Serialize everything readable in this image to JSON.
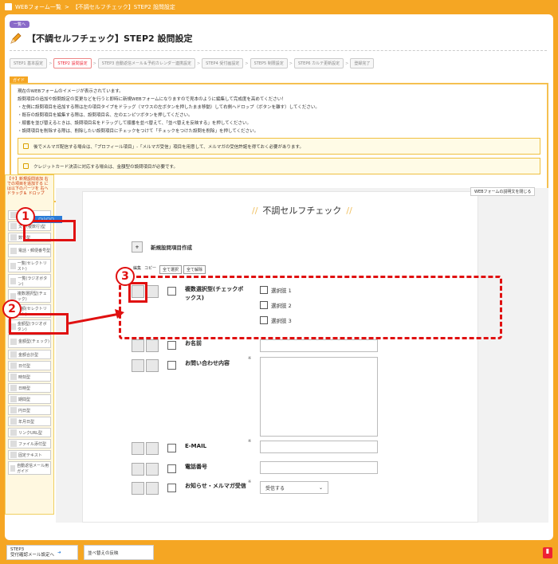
{
  "topbar": {
    "crumb1": "WEBフォーム一覧",
    "crumb2": "【不調セルフチェック】STEP2 設問設定"
  },
  "page": {
    "prev_label": "一覧へ",
    "title": "【不調セルフチェック】STEP2 設問設定"
  },
  "steps": [
    {
      "label": "STEP1 基本設定",
      "active": false
    },
    {
      "label": "STEP2 設問設定",
      "active": true
    },
    {
      "label": "STEP3 自動返信メール＆予約カレンダー連携設定",
      "active": false
    },
    {
      "label": "STEP4 受付画設定",
      "active": false
    },
    {
      "label": "STEP5 制限設定",
      "active": false
    },
    {
      "label": "STEP6 カルテ更新設定",
      "active": false
    },
    {
      "label": "登録完了",
      "active": false
    }
  ],
  "guide": {
    "label": "ガイド",
    "lines": [
      "現在のWEBフォームのイメージが表示されています。",
      "設問項目の追加や設問設定の変更などを行うと即時に新規WEBフォームになりますので見本のように編集して完成度を高めてください！",
      "・左側に設問項目を追加する際は左の項目タイプをドラッグ（マウスの左ボタンを押したまま移動）して右側へドロップ（ボタンを離す）してください。",
      "・既存の設問項目を編集する際は、設問項目名、左のエンピツボタンを押してください。",
      "・順番を並び替えるときは、設問項目名をドラッグして順番を並べ替えて、「並べ替えを反映する」を押してください。",
      "・設問項目を削除する際は、削除したい設問項目にチェックをつけて「チェックをつけた設問を削除」を押してください。"
    ],
    "note1": "後でメルマガ配信する場合は、「プロフィール項目」-「メルマガ受信」項目を用意して、メルマガの受信許諾を得ておく必要があります。",
    "note2": "クレジットカード決済に対応する場合は、金額型の設問項目が必要です。"
  },
  "sidebar": {
    "header": "【十】新規設問追加 右での項目を追加する には以下のパーツを 右へドラッグ＆ ドロップ",
    "blue_item": "ロ山ロロ",
    "items": [
      "氏名",
      "文字(複数行)型",
      "数字型",
      "電話・郵便番号型",
      "一覧(セレクトリスト)",
      "一覧(ラジオボタン)",
      "複数選択型(チェック)",
      "金額(セレクトリスト)",
      "金額型(ラジオボタン)",
      "金額型(チェック)",
      "金額合計型",
      "日付型",
      "時刻型",
      "日時型",
      "期間型",
      "円日型",
      "年月日型",
      "リンクURL型",
      "ファイル添付型",
      "固定テキスト",
      "自動返信メール用ガイド"
    ]
  },
  "main": {
    "full_button": "WEBフォームの説明文を閉じる",
    "form_title": "不調セルフチェック",
    "new_question": "新規設問項目作成",
    "tools": {
      "edit": "編集",
      "copy": "コピー",
      "select_all": "全て選択",
      "deselect_all": "全て解除"
    },
    "questions": [
      {
        "label": "複数選択型(チェックボックス)",
        "options": [
          "選択肢 1",
          "選択肢 2",
          "選択肢 3"
        ]
      },
      {
        "label": "お名前"
      },
      {
        "label": "お問い合わせ内容",
        "required": "※"
      },
      {
        "label": "E-MAIL",
        "required": "※"
      },
      {
        "label": "電話番号"
      },
      {
        "label": "お知らせ・メルマガ受信",
        "required": "※",
        "select": "受信する"
      }
    ]
  },
  "bottom": {
    "step3_line1": "STEP3",
    "step3_line2": "受付確認メール設定へ",
    "reorder": "並べ替えの反映"
  },
  "callouts": [
    "1",
    "2",
    "3"
  ],
  "colors": {
    "accent": "#f5a623",
    "red": "#e01010",
    "blue": "#2a7cd8"
  }
}
